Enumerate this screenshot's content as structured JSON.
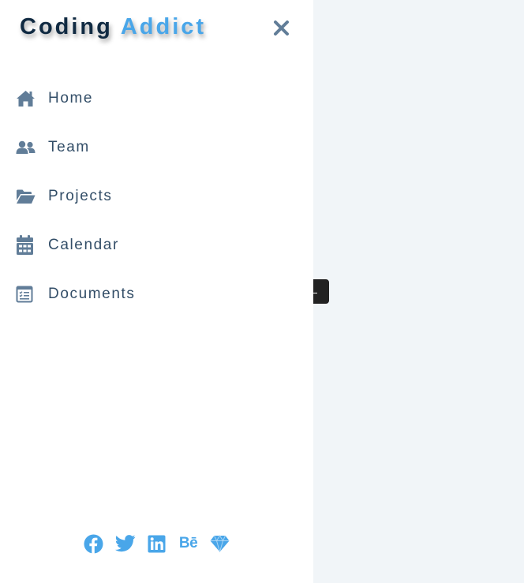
{
  "logo": {
    "part1": "Coding",
    "part2": "Addict"
  },
  "colors": {
    "accent": "#49a6e9",
    "text": "#324d67",
    "icon": "#617d98",
    "background": "#f1f5f8"
  },
  "nav": [
    {
      "label": "Home",
      "icon": "home-icon"
    },
    {
      "label": "Team",
      "icon": "users-icon"
    },
    {
      "label": "Projects",
      "icon": "folder-open-icon"
    },
    {
      "label": "Calendar",
      "icon": "calendar-icon"
    },
    {
      "label": "Documents",
      "icon": "document-icon"
    }
  ],
  "social": [
    "facebook-icon",
    "twitter-icon",
    "linkedin-icon",
    "behance-icon",
    "sketch-icon"
  ]
}
